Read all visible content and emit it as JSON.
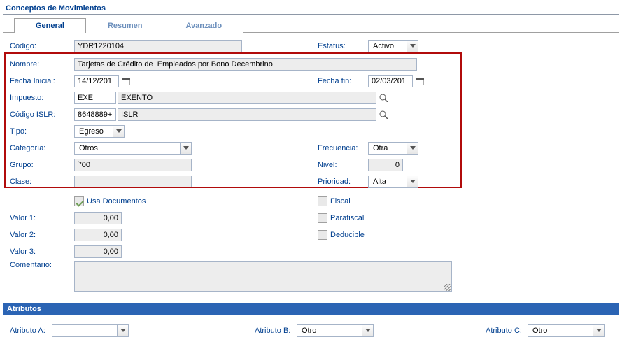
{
  "section": {
    "title": "Conceptos de Movimientos"
  },
  "tabs": {
    "general": "General",
    "resumen": "Resumen",
    "avanzado": "Avanzado"
  },
  "labels": {
    "codigo": "Código:",
    "estatus": "Estatus:",
    "nombre": "Nombre:",
    "fechaInicial": "Fecha Inicial:",
    "fechaFin": "Fecha fin:",
    "impuesto": "Impuesto:",
    "codigoIslr": "Código ISLR:",
    "tipo": "Tipo:",
    "categoria": "Categoría:",
    "frecuencia": "Frecuencia:",
    "grupo": "Grupo:",
    "nivel": "Nivel:",
    "clase": "Clase:",
    "prioridad": "Prioridad:",
    "usaDoc": "Usa Documentos",
    "fiscal": "Fiscal",
    "valor1": "Valor 1:",
    "parafiscal": "Parafiscal",
    "valor2": "Valor 2:",
    "deducible": "Deducible",
    "valor3": "Valor 3:",
    "comentario": "Comentario:"
  },
  "values": {
    "codigo": "YDR1220104",
    "estatus": "Activo",
    "nombre": "Tarjetas de Crédito de  Empleados por Bono Decembrino",
    "fechaInicial": "14/12/201",
    "fechaFin": "02/03/201",
    "impuestoCode": "EXE",
    "impuestoDesc": "EXENTO",
    "islrCode": "8648889+",
    "islrDesc": "ISLR",
    "tipo": "Egreso",
    "categoria": "Otros",
    "frecuencia": "Otra",
    "grupo": "`'00",
    "nivel": "0",
    "clase": "",
    "prioridad": "Alta",
    "valor1": "0,00",
    "valor2": "0,00",
    "valor3": "0,00",
    "comentario": ""
  },
  "checkboxes": {
    "usaDoc": true,
    "fiscal": false,
    "parafiscal": false,
    "deducible": false
  },
  "attributes": {
    "title": "Atributos",
    "a": {
      "label": "Atributo A:",
      "value": ""
    },
    "b": {
      "label": "Atributo B:",
      "value": "Otro"
    },
    "c": {
      "label": "Atributo C:",
      "value": "Otro"
    }
  }
}
